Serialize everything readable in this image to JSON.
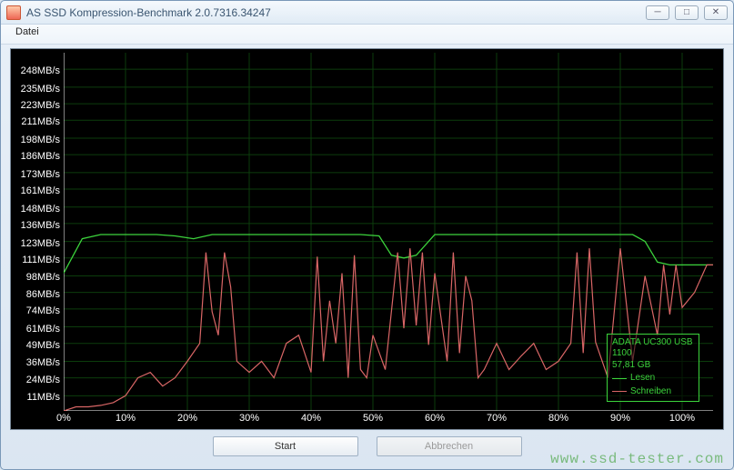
{
  "window": {
    "title": "AS SSD Kompression-Benchmark 2.0.7316.34247",
    "menu": {
      "file": "Datei"
    },
    "buttons": {
      "min": "─",
      "max": "□",
      "close": "✕"
    }
  },
  "buttons": {
    "start": "Start",
    "cancel": "Abbrechen"
  },
  "legend": {
    "device": "ADATA UC300 USB 1100",
    "size": "57,81 GB",
    "read": "Lesen",
    "write": "Schreiben",
    "colors": {
      "read": "#3cd43c",
      "write": "#d96666"
    }
  },
  "watermark": "www.ssd-tester.com",
  "chart_data": {
    "type": "line",
    "xlabel": "",
    "ylabel": "",
    "x_unit": "%",
    "y_unit": "MB/s",
    "xlim": [
      0,
      105
    ],
    "ylim": [
      0,
      260
    ],
    "y_ticks": [
      11,
      24,
      36,
      49,
      61,
      74,
      86,
      98,
      111,
      123,
      136,
      148,
      161,
      173,
      186,
      198,
      211,
      223,
      235,
      248
    ],
    "y_tick_labels": [
      "11MB/s",
      "24MB/s",
      "36MB/s",
      "49MB/s",
      "61MB/s",
      "74MB/s",
      "86MB/s",
      "98MB/s",
      "111MB/s",
      "123MB/s",
      "136MB/s",
      "148MB/s",
      "161MB/s",
      "173MB/s",
      "186MB/s",
      "198MB/s",
      "211MB/s",
      "223MB/s",
      "235MB/s",
      "248MB/s"
    ],
    "x_ticks": [
      0,
      10,
      20,
      30,
      40,
      50,
      60,
      70,
      80,
      90,
      100
    ],
    "x_tick_labels": [
      "0%",
      "10%",
      "20%",
      "30%",
      "40%",
      "50%",
      "60%",
      "70%",
      "80%",
      "90%",
      "100%"
    ],
    "series": [
      {
        "name": "Lesen",
        "color": "#3cd43c",
        "x": [
          0,
          3,
          6,
          9,
          12,
          15,
          18,
          21,
          24,
          27,
          30,
          33,
          36,
          39,
          42,
          45,
          48,
          51,
          53,
          55,
          57,
          60,
          63,
          66,
          69,
          72,
          75,
          78,
          81,
          84,
          87,
          90,
          92,
          94,
          96,
          98,
          100,
          103,
          105
        ],
        "y": [
          100,
          125,
          128,
          128,
          128,
          128,
          127,
          125,
          128,
          128,
          128,
          128,
          128,
          128,
          128,
          128,
          128,
          127,
          113,
          111,
          113,
          128,
          128,
          128,
          128,
          128,
          128,
          128,
          128,
          128,
          128,
          128,
          128,
          123,
          108,
          106,
          106,
          106,
          106
        ]
      },
      {
        "name": "Schreiben",
        "color": "#d96666",
        "x": [
          0,
          2,
          4,
          6,
          8,
          10,
          12,
          14,
          16,
          18,
          20,
          22,
          23,
          24,
          25,
          26,
          27,
          28,
          30,
          32,
          34,
          36,
          38,
          40,
          41,
          42,
          43,
          44,
          45,
          46,
          47,
          48,
          49,
          50,
          52,
          54,
          55,
          56,
          57,
          58,
          59,
          60,
          62,
          63,
          64,
          65,
          66,
          67,
          68,
          70,
          72,
          74,
          76,
          78,
          80,
          82,
          83,
          84,
          85,
          86,
          88,
          90,
          92,
          94,
          96,
          97,
          98,
          99,
          100,
          102,
          104,
          105
        ],
        "y": [
          0,
          3,
          3,
          4,
          6,
          11,
          24,
          28,
          18,
          24,
          36,
          49,
          115,
          72,
          55,
          115,
          90,
          36,
          28,
          36,
          24,
          49,
          55,
          28,
          112,
          36,
          80,
          49,
          100,
          24,
          113,
          30,
          24,
          55,
          30,
          115,
          60,
          118,
          62,
          115,
          48,
          100,
          36,
          115,
          42,
          98,
          80,
          24,
          30,
          49,
          30,
          40,
          49,
          30,
          36,
          49,
          115,
          42,
          118,
          50,
          24,
          118,
          36,
          98,
          55,
          106,
          70,
          106,
          75,
          86,
          106,
          106
        ]
      }
    ]
  }
}
